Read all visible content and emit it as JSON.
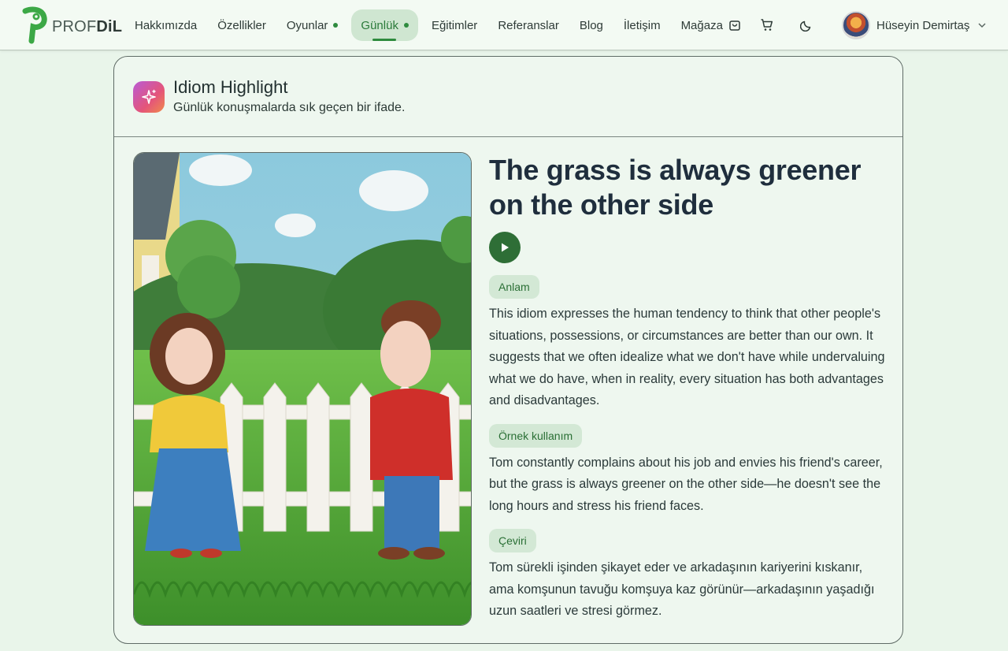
{
  "brand": {
    "logo_light": "PROF",
    "logo_bold": "DiL"
  },
  "nav": {
    "items": [
      {
        "label": "Hakkımızda"
      },
      {
        "label": "Özellikler"
      },
      {
        "label": "Oyunlar"
      },
      {
        "label": "Günlük"
      },
      {
        "label": "Eğitimler"
      },
      {
        "label": "Referanslar"
      },
      {
        "label": "Blog"
      },
      {
        "label": "İletişim"
      },
      {
        "label": "Mağaza"
      }
    ],
    "active": "Günlük"
  },
  "user": {
    "name": "Hüseyin Demirtaş"
  },
  "card": {
    "title": "Idiom Highlight",
    "subtitle": "Günlük konuşmalarda sık geçen bir ifade.",
    "idiom": "The grass is always greener on the other side",
    "meaning_label": "Anlam",
    "meaning": "This idiom expresses the human tendency to think that other people's situations, possessions, or circumstances are better than our own. It suggests that we often idealize what we don't have while undervaluing what we do have, when in reality, every situation has both advantages and disadvantages.",
    "example_label": "Örnek kullanım",
    "example": "Tom constantly complains about his job and envies his friend's career, but the grass is always greener on the other side—he doesn't see the long hours and stress his friend faces.",
    "translation_label": "Çeviri",
    "translation": "Tom sürekli işinden şikayet eder ve arkadaşının kariyerini kıskanır, ama komşunun tavuğu komşuya kaz görünür—arkadaşının yaşadığı uzun saatleri ve stresi görmez."
  },
  "colors": {
    "accent": "#2e8b3e",
    "play": "#2e6e36",
    "tag_bg": "#d3e8d5",
    "page_bg": "#e9f5ea"
  },
  "icons": [
    "logo-mark-icon",
    "cart-icon",
    "bag-icon",
    "moon-icon",
    "chevron-down-icon",
    "sparkle-icon",
    "play-icon"
  ]
}
